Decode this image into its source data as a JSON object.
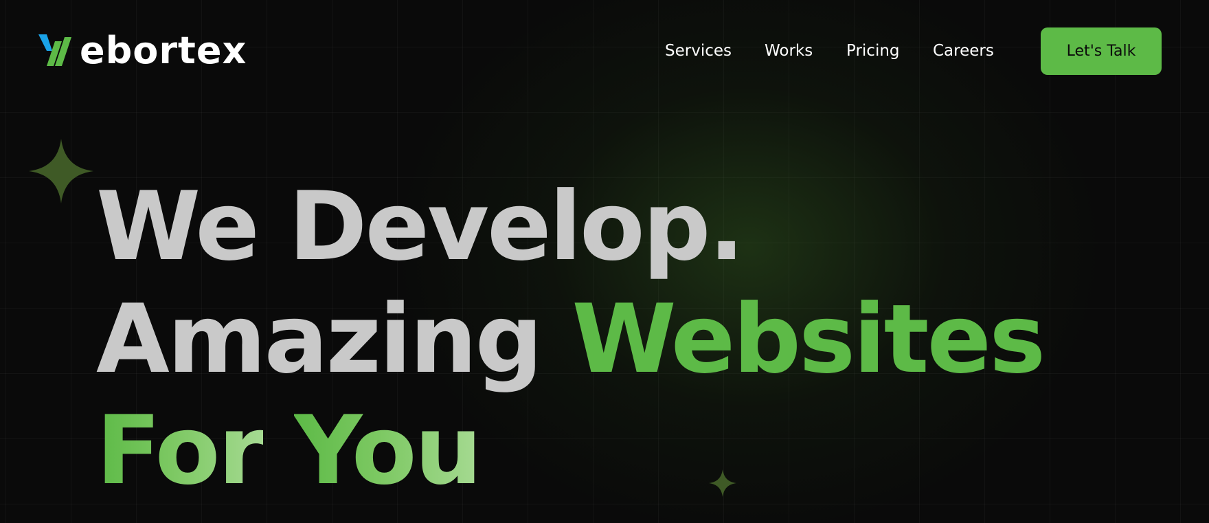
{
  "brand": {
    "logo_text": "ebortex",
    "logo_mark_colors": [
      "#1aa3e8",
      "#5dba47"
    ]
  },
  "nav": {
    "items": [
      {
        "label": "Services"
      },
      {
        "label": "Works"
      },
      {
        "label": "Pricing"
      },
      {
        "label": "Careers"
      }
    ]
  },
  "cta": {
    "label": "Let's Talk",
    "color": "#5dba47"
  },
  "hero": {
    "line1": {
      "part1": "We",
      "part2": "Develop."
    },
    "line2": {
      "part1": "Amazing",
      "part2": "Websites"
    },
    "line3": {
      "part1": "For",
      "part2": "You"
    },
    "colors": {
      "text": "#c9c9c9",
      "accent": "#5dba47"
    }
  },
  "decorations": {
    "icons": [
      "sparkle-star-icon",
      "sparkle-star-icon"
    ],
    "star_color": "#3f5a26"
  },
  "theme": {
    "background": "#0a0a0a",
    "glow": "#4a8c2c"
  }
}
